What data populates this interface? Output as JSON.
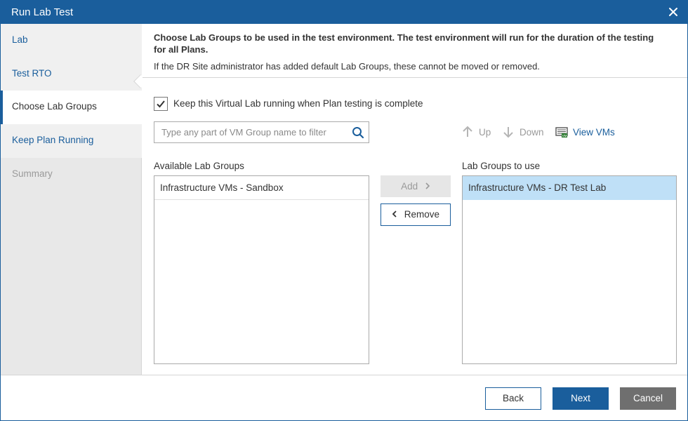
{
  "window": {
    "title": "Run Lab Test"
  },
  "sidebar": {
    "steps": [
      {
        "label": "Lab",
        "state": "done"
      },
      {
        "label": "Test RTO",
        "state": "done"
      },
      {
        "label": "Choose Lab Groups",
        "state": "active"
      },
      {
        "label": "Keep Plan Running",
        "state": "done"
      },
      {
        "label": "Summary",
        "state": "disabled"
      }
    ]
  },
  "header": {
    "description": "Choose Lab Groups to be used in the test environment. The test environment will run for the duration of the testing for all Plans.",
    "note": "If the DR Site administrator has added default Lab Groups, these cannot be moved or removed."
  },
  "options": {
    "keep_running_label": "Keep this Virtual Lab running when Plan testing is complete",
    "keep_running_checked": true
  },
  "filter": {
    "placeholder": "Type any part of VM Group name to filter",
    "value": ""
  },
  "toolbar": {
    "up_label": "Up",
    "down_label": "Down",
    "view_vms_label": "View VMs"
  },
  "available": {
    "label": "Available Lab Groups",
    "items": [
      "Infrastructure VMs - Sandbox"
    ]
  },
  "selected": {
    "label": "Lab Groups to use",
    "items": [
      "Infrastructure VMs - DR Test Lab"
    ]
  },
  "transfer": {
    "add_label": "Add",
    "remove_label": "Remove"
  },
  "footer": {
    "back_label": "Back",
    "next_label": "Next",
    "cancel_label": "Cancel"
  },
  "colors": {
    "accent": "#1a5e9c",
    "selection": "#bfe0f7",
    "cancel": "#6f6f6f",
    "disabled_text": "#9a9a9a"
  }
}
